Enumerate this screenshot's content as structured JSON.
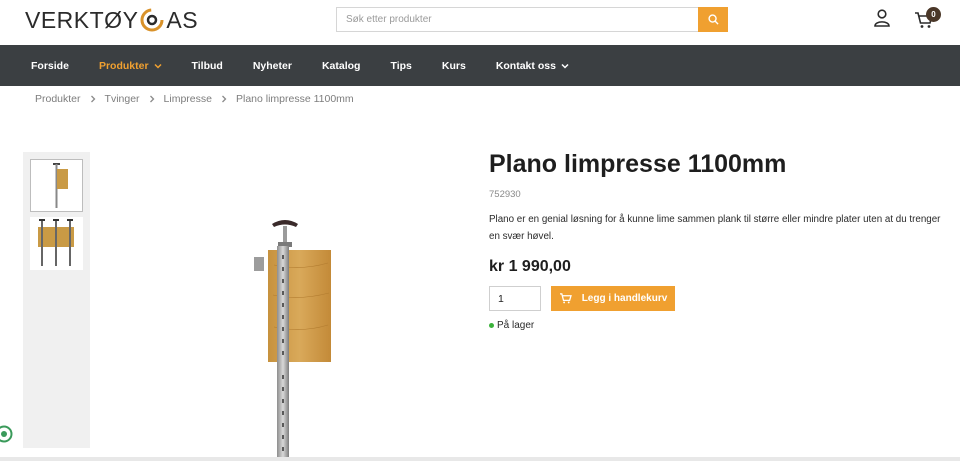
{
  "header": {
    "logo_left": "VERKTØY",
    "logo_right": "AS",
    "search_placeholder": "Søk etter produkter",
    "cart_count": "0"
  },
  "nav": {
    "items": [
      {
        "label": "Forside"
      },
      {
        "label": "Produkter"
      },
      {
        "label": "Tilbud"
      },
      {
        "label": "Nyheter"
      },
      {
        "label": "Katalog"
      },
      {
        "label": "Tips"
      },
      {
        "label": "Kurs"
      },
      {
        "label": "Kontakt oss"
      }
    ]
  },
  "breadcrumb": {
    "items": [
      "Produkter",
      "Tvinger",
      "Limpresse",
      "Plano limpresse 1100mm"
    ]
  },
  "product": {
    "title": "Plano limpresse 1100mm",
    "sku": "752930",
    "description": "Plano er en genial løsning for å kunne lime sammen plank til større eller mindre plater uten at du trenger en svær høvel.",
    "price": "kr 1 990,00",
    "quantity": "1",
    "add_to_cart_label": "Legg i handlekurv",
    "stock_status": "På lager"
  },
  "colors": {
    "accent": "#f0a030",
    "nav_bg": "#3b3f42",
    "in_stock": "#3bb23b"
  }
}
